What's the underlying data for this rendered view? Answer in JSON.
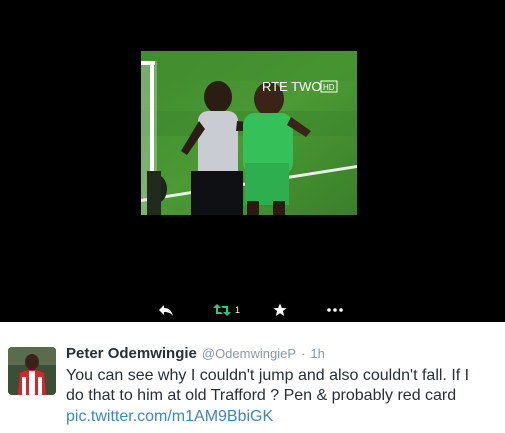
{
  "media": {
    "broadcast_logo": "RTE TWO",
    "broadcast_logo_badge": "HD"
  },
  "actions": {
    "reply_icon": "reply-icon",
    "retweet_icon": "retweet-icon",
    "retweet_count": "1",
    "favorite_icon": "star-icon",
    "more_icon": "more-dots-icon",
    "retweet_color": "#19cf86"
  },
  "tweet": {
    "display_name": "Peter Odemwingie",
    "handle": "@OdemwingieP",
    "separator": "·",
    "time": "1h",
    "text_lines": [
      "You can see why I couldn't jump and also couldn't fall. If I",
      "do that to him at old Trafford ? Pen & probably red card"
    ],
    "link": "pic.twitter.com/m1AM9BbiGK",
    "link_color": "#3b88c3"
  }
}
